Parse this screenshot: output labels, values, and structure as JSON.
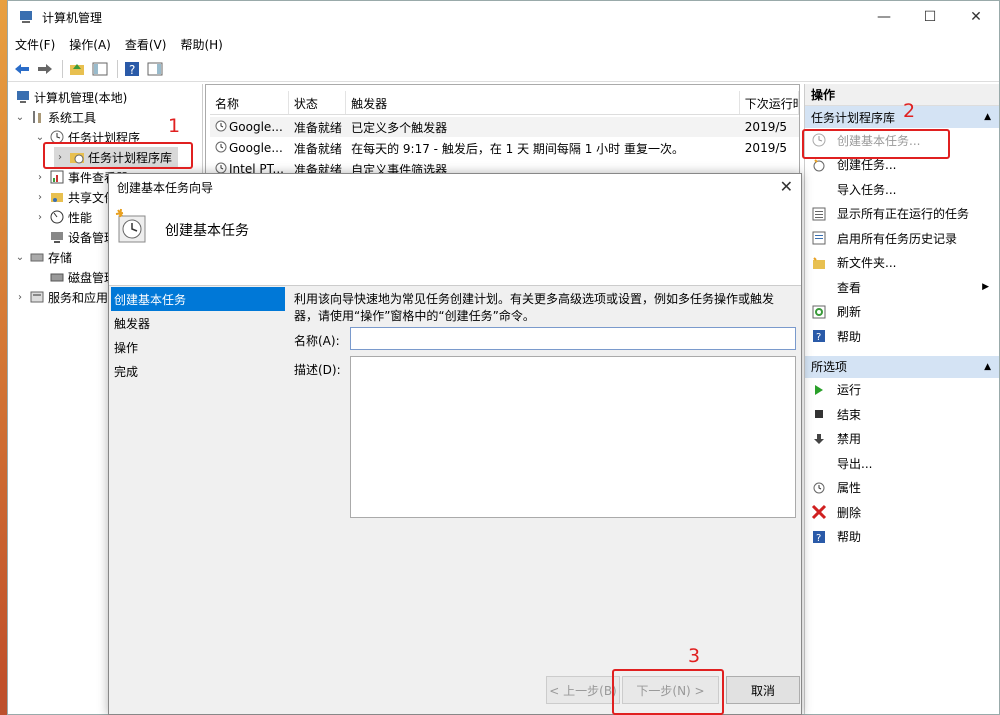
{
  "window": {
    "title": "计算机管理"
  },
  "menu": [
    "文件(F)",
    "操作(A)",
    "查看(V)",
    "帮助(H)"
  ],
  "tree": {
    "items": [
      {
        "label": "计算机管理(本地)"
      },
      {
        "label": "系统工具"
      },
      {
        "label": "任务计划程序"
      },
      {
        "label": "任务计划程序库"
      },
      {
        "label": "事件查看器"
      },
      {
        "label": "共享文件夹"
      },
      {
        "label": "性能"
      },
      {
        "label": "设备管理器"
      },
      {
        "label": "存储"
      },
      {
        "label": "磁盘管理"
      },
      {
        "label": "服务和应用程序"
      }
    ]
  },
  "list": {
    "columns": [
      "名称",
      "状态",
      "触发器",
      "下次运行时间"
    ],
    "rows": [
      {
        "name": "Google...",
        "status": "准备就绪",
        "trigger": "已定义多个触发器",
        "next": "2019/5"
      },
      {
        "name": "Google...",
        "status": "准备就绪",
        "trigger": "在每天的 9:17 - 触发后，在 1 天 期间每隔 1 小时 重复一次。",
        "next": "2019/5"
      },
      {
        "name": "Intel PT...",
        "status": "准备就绪",
        "trigger": "自定义事件筛选器",
        "next": ""
      }
    ]
  },
  "actions": {
    "header": "操作",
    "group1": "任务计划程序库",
    "items1": [
      "创建基本任务...",
      "创建任务...",
      "导入任务...",
      "显示所有正在运行的任务",
      "启用所有任务历史记录",
      "新文件夹...",
      "查看",
      "刷新",
      "帮助"
    ],
    "group2": "所选项",
    "items2": [
      "运行",
      "结束",
      "禁用",
      "导出...",
      "属性",
      "删除",
      "帮助"
    ]
  },
  "dialog": {
    "title": "创建基本任务向导",
    "header": "创建基本任务",
    "steps": [
      "创建基本任务",
      "触发器",
      "操作",
      "完成"
    ],
    "description": "利用该向导快速地为常见任务创建计划。有关更多高级选项或设置，例如多任务操作或触发器，请使用“操作”窗格中的“创建任务”命令。",
    "name_label": "名称(A):",
    "name_value": "",
    "desc_label": "描述(D):",
    "desc_value": "",
    "back": "< 上一步(B)",
    "next": "下一步(N) >",
    "cancel": "取消"
  },
  "annotations": [
    "1",
    "2",
    "3"
  ]
}
